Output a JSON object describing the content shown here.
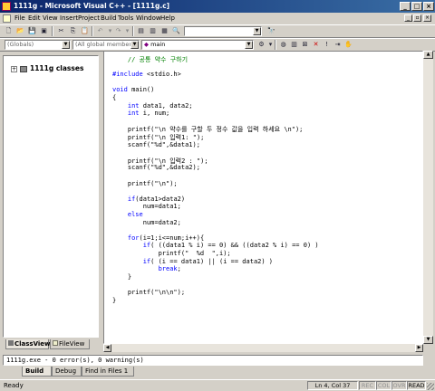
{
  "window": {
    "title": "1111g - Microsoft Visual C++ - [1111g.c]",
    "controls": {
      "minimize": "_",
      "maximize": "□",
      "close": "×"
    }
  },
  "menu": [
    "File",
    "Edit",
    "View",
    "Insert",
    "Project",
    "Build",
    "Tools",
    "Window",
    "Help"
  ],
  "toolbar": {
    "find_combo_value": "",
    "class_combo": "(Globals)",
    "members_combo": "(All global members",
    "function_combo": "main"
  },
  "workspace": {
    "tree_root": "1111g classes",
    "tabs": [
      "ClassView",
      "FileView"
    ]
  },
  "editor": {
    "lines": [
      [
        {
          "t": "    // 공통 약수 구하기",
          "c": "cm"
        }
      ],
      [
        {
          "t": ""
        }
      ],
      [
        {
          "t": "#include",
          "c": "kw"
        },
        {
          "t": " <stdio.h>"
        }
      ],
      [
        {
          "t": ""
        }
      ],
      [
        {
          "t": "void",
          "c": "kw"
        },
        {
          "t": " main()"
        }
      ],
      [
        {
          "t": "{"
        }
      ],
      [
        {
          "t": "    "
        },
        {
          "t": "int",
          "c": "kw"
        },
        {
          "t": " data1, data2;"
        }
      ],
      [
        {
          "t": "    "
        },
        {
          "t": "int",
          "c": "kw"
        },
        {
          "t": " i, num;"
        }
      ],
      [
        {
          "t": ""
        }
      ],
      [
        {
          "t": "    printf(\"\\n 약수를 구할 두 정수 값을 입력 하세요 \\n\");"
        }
      ],
      [
        {
          "t": "    printf(\"\\n 입력1: \");"
        }
      ],
      [
        {
          "t": "    scanf(\"%d\",&data1);"
        }
      ],
      [
        {
          "t": ""
        }
      ],
      [
        {
          "t": "    printf(\"\\n 입력2 : \");"
        }
      ],
      [
        {
          "t": "    scanf(\"%d\",&data2);"
        }
      ],
      [
        {
          "t": ""
        }
      ],
      [
        {
          "t": "    printf(\"\\n\");"
        }
      ],
      [
        {
          "t": ""
        }
      ],
      [
        {
          "t": "    "
        },
        {
          "t": "if",
          "c": "kw"
        },
        {
          "t": "(data1>data2)"
        }
      ],
      [
        {
          "t": "        num=data1;"
        }
      ],
      [
        {
          "t": "    "
        },
        {
          "t": "else",
          "c": "kw"
        }
      ],
      [
        {
          "t": "        num=data2;"
        }
      ],
      [
        {
          "t": ""
        }
      ],
      [
        {
          "t": "    "
        },
        {
          "t": "for",
          "c": "kw"
        },
        {
          "t": "(i=1;i<=num;i++){"
        }
      ],
      [
        {
          "t": "        "
        },
        {
          "t": "if",
          "c": "kw"
        },
        {
          "t": "( ((data1 % i) == 0) && ((data2 % i) == 0) )"
        }
      ],
      [
        {
          "t": "            printf(\"  %d  \",i);"
        }
      ],
      [
        {
          "t": "        "
        },
        {
          "t": "if",
          "c": "kw"
        },
        {
          "t": "( (i == data1) || (i == data2) )"
        }
      ],
      [
        {
          "t": "            "
        },
        {
          "t": "break",
          "c": "kw"
        },
        {
          "t": ";"
        }
      ],
      [
        {
          "t": "    }"
        }
      ],
      [
        {
          "t": ""
        }
      ],
      [
        {
          "t": "    printf(\"\\n\\n\");"
        }
      ],
      [
        {
          "t": "}"
        }
      ]
    ]
  },
  "output": {
    "text": "1111g.exe - 0 error(s), 0 warning(s)",
    "tabs": [
      "Build",
      "Debug",
      "Find in Files 1"
    ]
  },
  "status": {
    "text": "Ready",
    "position": "Ln 4, Col 37",
    "indicators": [
      "REC",
      "COL",
      "OVR",
      "READ"
    ]
  },
  "colors": {
    "keyword": "#0000ff",
    "comment": "#008000",
    "titlebar_start": "#0a246a",
    "titlebar_end": "#3a6ea5",
    "chrome": "#d4d0c8"
  }
}
